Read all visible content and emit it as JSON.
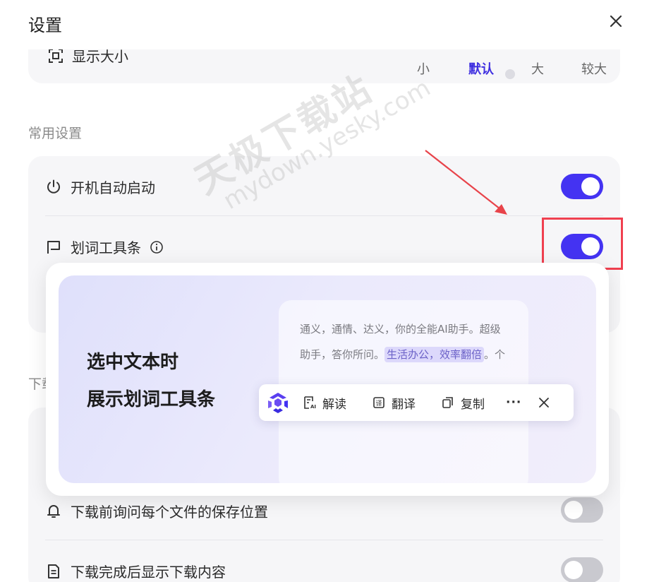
{
  "header": {
    "title": "设置"
  },
  "display_size": {
    "label": "显示大小",
    "options": [
      "小",
      "默认",
      "大",
      "较大"
    ],
    "selected": "默认"
  },
  "common_settings": {
    "section_title": "常用设置",
    "items": [
      {
        "label": "开机自动启动",
        "enabled": true
      },
      {
        "label": "划词工具条",
        "enabled": true
      }
    ]
  },
  "tooltip_popup": {
    "headline_1": "选中文本时",
    "headline_2": "展示划词工具条",
    "doc_line_1": "通义，通情、达义，你的全能AI助手。超级",
    "doc_line_2_a": "助手，答你所问。",
    "doc_line_2_highlight": "生活办公，效率翻倍",
    "doc_line_2_b": "。个",
    "toolbar": {
      "interpret": "解读",
      "translate": "翻译",
      "copy": "复制",
      "more": "···"
    }
  },
  "download_settings": {
    "section_title_partial": "下载",
    "items": [
      {
        "label": "下载前询问每个文件的保存位置",
        "enabled": false
      },
      {
        "label": "下载完成后显示下载内容",
        "enabled": false
      }
    ]
  },
  "watermark": {
    "line1": "天极下载站",
    "line2": "mydown.yesky.com"
  },
  "colors": {
    "accent": "#4433f2",
    "toggle_off": "#c9c9cf",
    "highlight_border": "#f04050",
    "arrow": "#e8434a"
  }
}
